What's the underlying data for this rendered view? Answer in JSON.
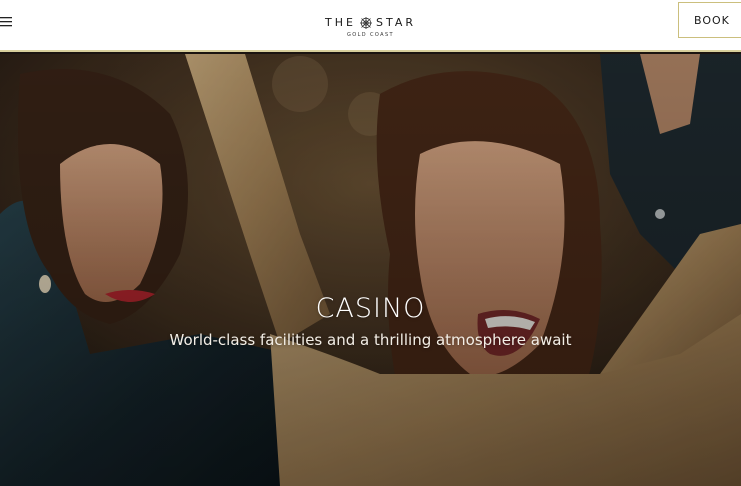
{
  "header": {
    "logo_main_left": "THE",
    "logo_main_right": "STAR",
    "logo_sub": "GOLD COAST",
    "book_label": "BOOK"
  },
  "hero": {
    "title": "CASINO",
    "subtitle": "World-class facilities and a thrilling atmosphere await"
  },
  "icons": {
    "menu": "hamburger-menu-icon",
    "logo_star": "star-emblem-icon"
  },
  "colors": {
    "header_bg": "#ffffff",
    "header_border": "#d8cf9c",
    "book_border": "#cbbf7d",
    "hero_text": "#ffffff"
  }
}
